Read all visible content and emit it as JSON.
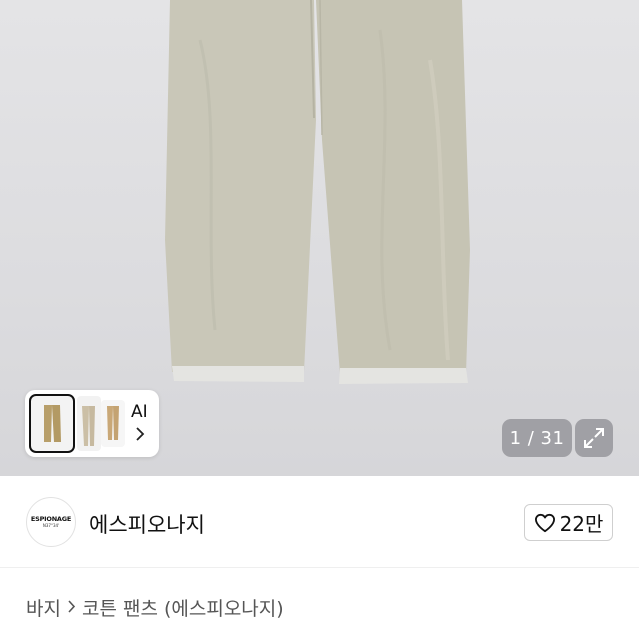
{
  "product_image": {
    "alt": "코튼 팬츠",
    "colors": {
      "background": "#dcdcdf",
      "pants": "#c9c7b8",
      "hem": "#e4e4e1"
    }
  },
  "thumbnail_strip": {
    "ai_label": "AI",
    "chevron_icon": "chevron-right-icon"
  },
  "gallery": {
    "counter": "1 / 31",
    "expand_icon": "expand-icon"
  },
  "seller": {
    "logo_text": "ESPIONAGE",
    "logo_subtext": "N37°34'",
    "name": "에스피오나지"
  },
  "like_button": {
    "icon": "heart-outline-icon",
    "count": "22만"
  },
  "breadcrumb": {
    "category": "바지",
    "separator_icon": "chevron-right-icon",
    "product": "코튼 팬츠 (에스피오나지)"
  }
}
